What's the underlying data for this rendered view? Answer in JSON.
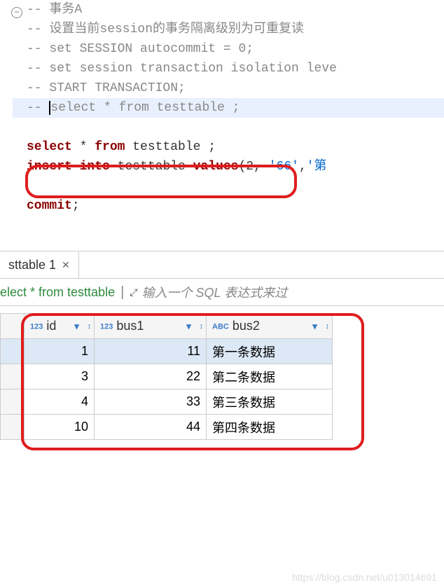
{
  "editor": {
    "fold_marker": "−",
    "lines": {
      "l1": "-- 事务A",
      "l2": "-- 设置当前session的事务隔离级别为可重复读",
      "l3": "-- set SESSION autocommit = 0;",
      "l4": "-- set session transaction isolation leve",
      "l5": "-- START TRANSACTION;",
      "l6_prefix": "-- ",
      "l6_text": "select * from testtable ;"
    },
    "select_kw": "select",
    "from_kw": "from",
    "star": " * ",
    "table": " testtable ",
    "semi": ";",
    "insert_kw": "insert",
    "into_kw": "into",
    "values_kw": "values",
    "insert_table": " testtable ",
    "insert_open": "(",
    "insert_n": "2",
    "insert_comma1": ", ",
    "insert_s1": "'66'",
    "insert_comma2": ",",
    "insert_s2": "'第",
    "commit_kw": "commit",
    "commit_semi": ";"
  },
  "tab": {
    "label": "sttable 1",
    "close": "✕"
  },
  "query_bar": {
    "query": "elect * from testtable",
    "placeholder": "输入一个 SQL 表达式来过"
  },
  "table": {
    "columns": {
      "id": {
        "type": "123",
        "name": "id"
      },
      "bus1": {
        "type": "123",
        "name": "bus1"
      },
      "bus2": {
        "type": "ABC",
        "name": "bus2"
      }
    },
    "rows": [
      {
        "id": "1",
        "bus1": "11",
        "bus2": "第一条数据"
      },
      {
        "id": "3",
        "bus1": "22",
        "bus2": "第二条数据"
      },
      {
        "id": "4",
        "bus1": "33",
        "bus2": "第三条数据"
      },
      {
        "id": "10",
        "bus1": "44",
        "bus2": "第四条数据"
      }
    ]
  },
  "watermark": "https://blog.csdn.net/u013014691"
}
